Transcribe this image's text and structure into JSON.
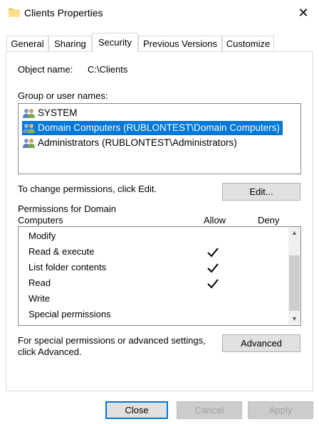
{
  "window": {
    "title": "Clients Properties",
    "close_glyph": "✕"
  },
  "tabs": [
    {
      "label": "General"
    },
    {
      "label": "Sharing"
    },
    {
      "label": "Security"
    },
    {
      "label": "Previous Versions"
    },
    {
      "label": "Customize"
    }
  ],
  "object": {
    "label": "Object name:",
    "value": "C:\\Clients"
  },
  "groups": {
    "label": "Group or user names:",
    "items": [
      {
        "name": "SYSTEM",
        "icon": "users-icon"
      },
      {
        "name": "Domain Computers (RUBLONTEST\\Domain Computers)",
        "icon": "users-icon",
        "selected": true
      },
      {
        "name": "Administrators (RUBLONTEST\\Administrators)",
        "icon": "users-icon"
      }
    ]
  },
  "change_text": "To change permissions, click Edit.",
  "edit_button": "Edit...",
  "permissions": {
    "header_line1": "Permissions for Domain",
    "header_line2": "Computers",
    "allow_label": "Allow",
    "deny_label": "Deny",
    "rows": [
      {
        "name": "Modify",
        "allow": false
      },
      {
        "name": "Read & execute",
        "allow": true
      },
      {
        "name": "List folder contents",
        "allow": true
      },
      {
        "name": "Read",
        "allow": true
      },
      {
        "name": "Write",
        "allow": false
      },
      {
        "name": "Special permissions",
        "allow": false
      }
    ]
  },
  "advanced": {
    "text_line1": "For special permissions or advanced settings,",
    "text_line2": "click Advanced.",
    "button": "Advanced"
  },
  "footer": {
    "close": "Close",
    "cancel": "Cancel",
    "apply": "Apply"
  },
  "colors": {
    "selection": "#0078d7",
    "default_button_border": "#0078d7"
  }
}
